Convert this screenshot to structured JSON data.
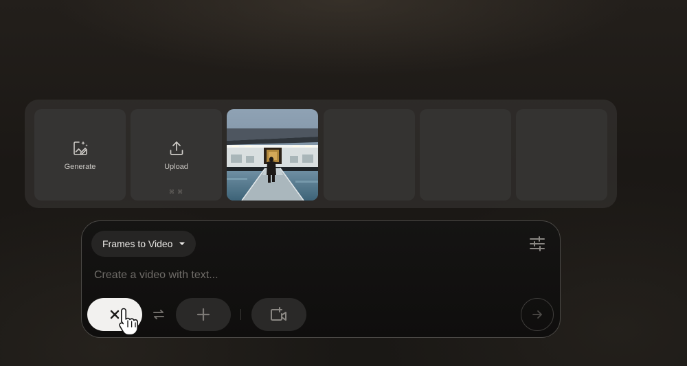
{
  "frame_strip": {
    "generate_label": "Generate",
    "generate_icon": "image-sparkle-icon",
    "upload_label": "Upload",
    "upload_icon": "upload-icon",
    "upload_hint": "⌘ ⌘",
    "selected_frame": "museum-corridor-image"
  },
  "composer": {
    "mode_label": "Frames to Video",
    "mode_caret_icon": "caret-down-icon",
    "settings_icon": "tune-sliders-icon",
    "prompt_placeholder": "Create a video with text...",
    "prompt_value": "",
    "clear_icon": "close-icon",
    "swap_icon": "swap-arrows-icon",
    "add_icon": "plus-icon",
    "add_video_icon": "add-video-icon",
    "send_icon": "arrow-right-icon"
  },
  "colors": {
    "background": "#1b1815",
    "tile": "#353433",
    "panel_border": "#4a4845",
    "clear_button": "#f2f1ef",
    "text_muted": "#6f6c68"
  }
}
